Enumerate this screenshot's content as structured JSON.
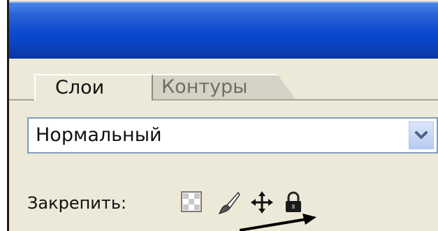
{
  "panel": {
    "tabs": [
      {
        "label": "Слои",
        "active": true
      },
      {
        "label": "Контуры",
        "active": false
      }
    ],
    "blend_mode": {
      "selected": "Нормальный"
    },
    "lock": {
      "label": "Закрепить:",
      "icons": [
        "lock-transparent-pixels-icon",
        "lock-image-pixels-brush-icon",
        "lock-position-move-icon",
        "lock-all-padlock-icon"
      ]
    }
  },
  "colors": {
    "titlebar": "#0a4ad0",
    "panel_bg": "#ece9d8",
    "select_border": "#7f9db9"
  }
}
